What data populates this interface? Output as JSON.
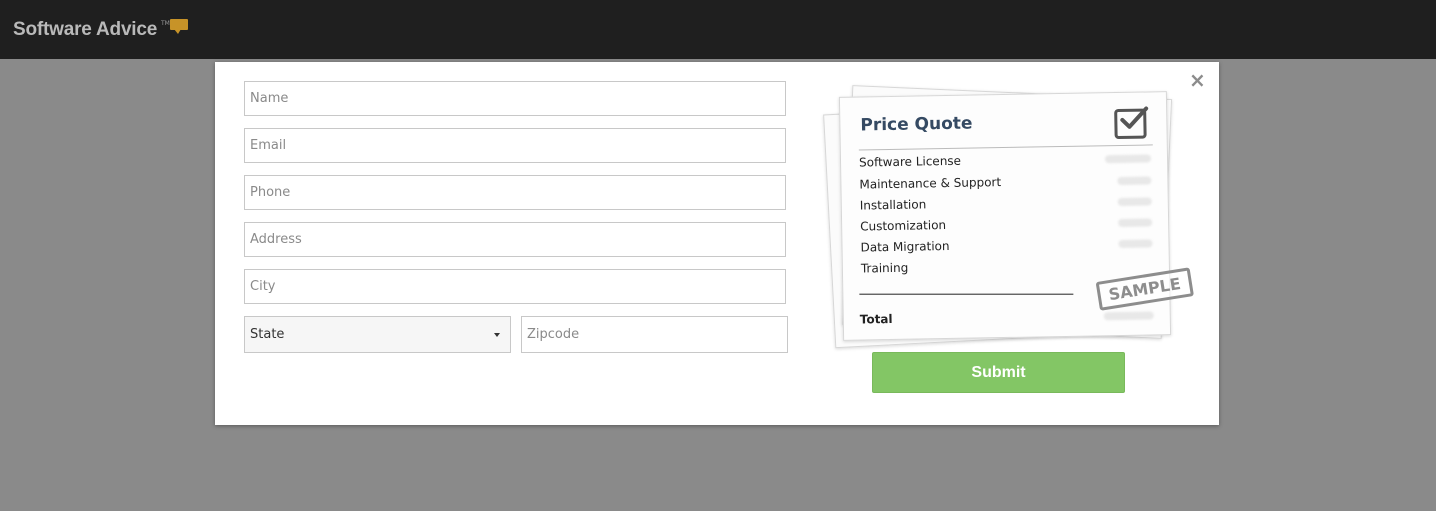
{
  "brand": {
    "name": "Software Advice",
    "tm": "TM",
    "accent": "#c79328"
  },
  "modal": {
    "close_label": "×",
    "form": {
      "name_placeholder": "Name",
      "email_placeholder": "Email",
      "phone_placeholder": "Phone",
      "address_placeholder": "Address",
      "city_placeholder": "City",
      "state_value": "State",
      "zipcode_placeholder": "Zipcode"
    },
    "quote": {
      "title": "Price Quote",
      "items": [
        "Software License",
        "Maintenance & Support",
        "Installation",
        "Customization",
        "Data Migration",
        "Training"
      ],
      "total_label": "Total",
      "stamp": "SAMPLE",
      "check_icon": "checkbox-check-icon"
    },
    "submit_label": "Submit",
    "submit_color": "#83c665"
  }
}
